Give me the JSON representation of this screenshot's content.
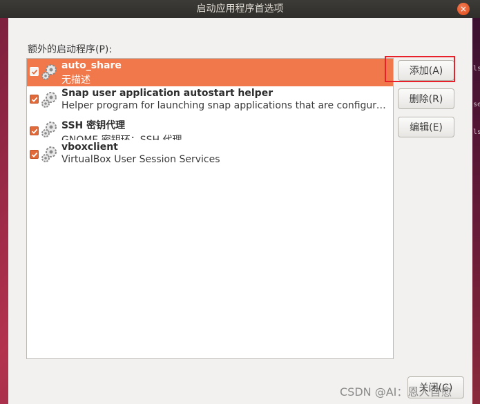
{
  "window": {
    "title": "启动应用程序首选项",
    "close_glyph": "×"
  },
  "section_label": "额外的启动程序(P):",
  "startup_items": [
    {
      "name": "auto_share",
      "description": "无描述",
      "checked": true,
      "selected": true,
      "icon": "gear-icon"
    },
    {
      "name": "Snap user application autostart helper",
      "description": "Helper program for launching snap applications that are configured to start automatically.",
      "checked": true,
      "selected": false,
      "icon": "gear-icon"
    },
    {
      "name": "SSH 密钥代理",
      "description": "GNOME 密钥环：SSH 代理",
      "checked": true,
      "selected": false,
      "icon": "gear-icon"
    },
    {
      "name": "vboxclient",
      "description": "VirtualBox User Session Services",
      "checked": true,
      "selected": false,
      "icon": "gear-icon"
    }
  ],
  "buttons": {
    "add": "添加(A)",
    "remove": "删除(R)",
    "edit": "编辑(E)",
    "close": "关闭(C)"
  },
  "watermark": "CSDN @AI：恩人自愈",
  "background_peek": [
    "ls",
    "se",
    "ls"
  ],
  "colors": {
    "selection": "#f0784a",
    "checkbox": "#e06a3a",
    "highlight_box": "#e8202a",
    "titlebar": "#3c3b37"
  }
}
